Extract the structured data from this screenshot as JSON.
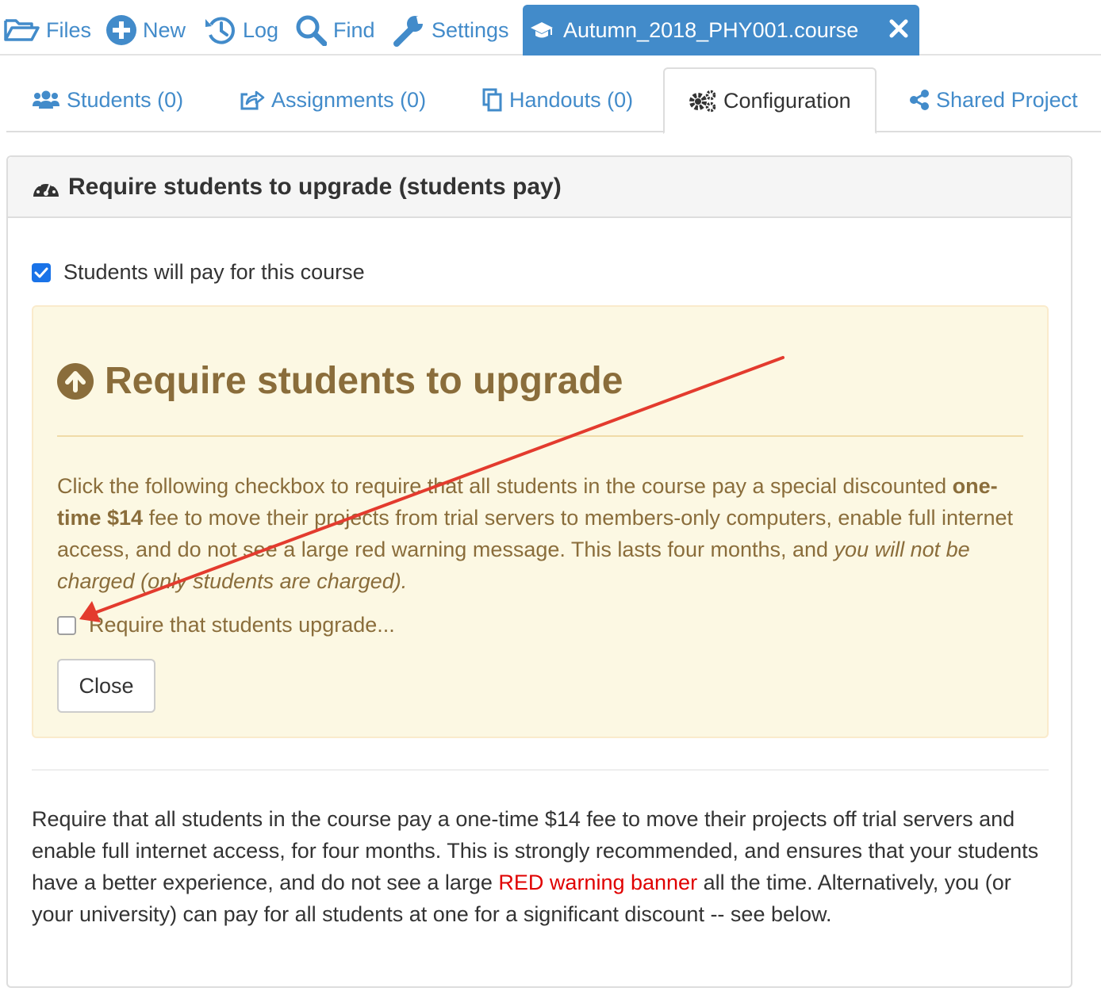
{
  "topnav": {
    "files": "Files",
    "new": "New",
    "log": "Log",
    "find": "Find",
    "settings": "Settings",
    "course_tab": "Autumn_2018_PHY001.course"
  },
  "tabs": {
    "students": "Students (0)",
    "assignments": "Assignments (0)",
    "handouts": "Handouts (0)",
    "configuration": "Configuration",
    "shared_project": "Shared Project",
    "active": "configuration"
  },
  "panel": {
    "heading": "Require students to upgrade (students pay)",
    "pay_checkbox_label": "Students will pay for this course",
    "pay_checkbox_checked": true
  },
  "well": {
    "title": "Require students to upgrade",
    "text_1": "Click the following checkbox to require that all students in the course pay a special discounted ",
    "text_bold": "one-time $14",
    "text_2": " fee to move their projects from trial servers to members-only computers, enable full internet access, and do not see a large red warning message. This lasts four months, and ",
    "text_italic": "you will not be charged (only students are charged).",
    "require_checkbox_label": "Require that students upgrade...",
    "require_checkbox_checked": false,
    "close_button": "Close"
  },
  "description": {
    "part_1": "Require that all students in the course pay a one-time $14 fee to move their projects off trial servers and enable full internet access, for four months. This is strongly recommended, and ensures that your students have a better experience, and do not see a large ",
    "red_text": "RED warning banner",
    "part_2": " all the time. Alternatively, you (or your university) can pay for all students at one for a significant discount -- see below."
  },
  "colors": {
    "link_blue": "#428bca",
    "warning_bg": "#fcf8e3",
    "warning_text": "#8a6d3b",
    "annotation_arrow": "#e33b2e",
    "red_banner_text": "#e00000"
  }
}
